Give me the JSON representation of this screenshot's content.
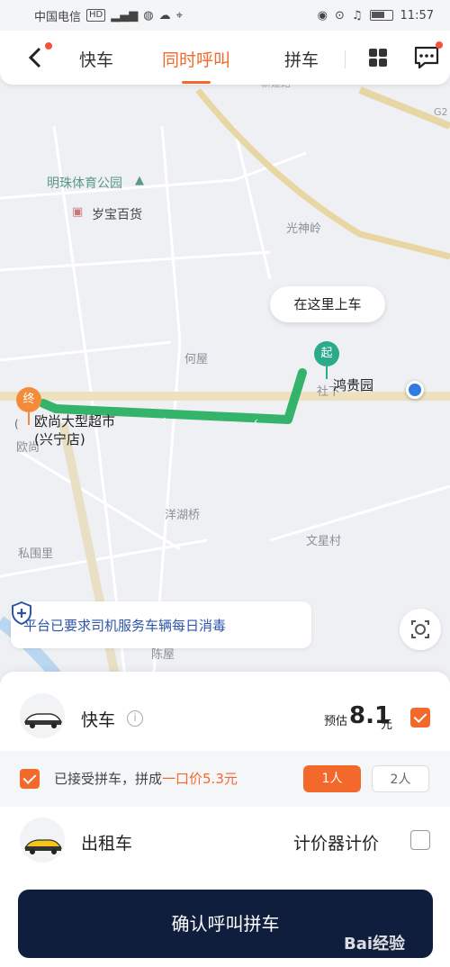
{
  "status_bar": {
    "carrier": "中国电信",
    "hd": "HD",
    "time": "11:57"
  },
  "nav": {
    "tabs": [
      {
        "label": "快车",
        "active": false
      },
      {
        "label": "同时呼叫",
        "active": true
      },
      {
        "label": "拼车",
        "active": false
      }
    ]
  },
  "map": {
    "labels": {
      "park": "明珠体育公园",
      "store": "岁宝百货",
      "guangshenling": "光神岭",
      "hewu": "何屋",
      "shexia": "社下",
      "yanghuqiao": "洋湖桥",
      "wenxingcun": "文星村",
      "siweili": "私围里",
      "ouxiang": "欧尚",
      "chenwu": "陈屋",
      "road": "G2",
      "top_road": "新建路"
    },
    "pickup_bubble": "在这里上车",
    "start_pin": "起",
    "end_pin": "终",
    "start_name": "鸿贵园",
    "end_name_line1": "欧尚大型超市",
    "end_name_line2": "(兴宁店)",
    "end_name_prefix": "(",
    "notice": "平台已要求司机服务车辆每日消毒"
  },
  "services": {
    "express": {
      "name": "快车",
      "estimate_label": "预估",
      "price": "8.1",
      "unit": "元",
      "checked": true
    },
    "pool": {
      "text_prefix": "已接受拼车，拼成",
      "highlight": "一口价5.3元",
      "checked": true,
      "seats": [
        "1人",
        "2人"
      ],
      "selected_seat": "1人"
    },
    "taxi": {
      "name": "出租车",
      "pricing": "计价器计价",
      "checked": false
    }
  },
  "confirm_button": "确认呼叫拼车",
  "watermark": "Bai经验",
  "colors": {
    "accent": "#f3692b",
    "route": "#34b36a",
    "start": "#2bab8a",
    "end": "#f48b3a",
    "button": "#0f1e3c",
    "notice_text": "#2c55a8"
  }
}
